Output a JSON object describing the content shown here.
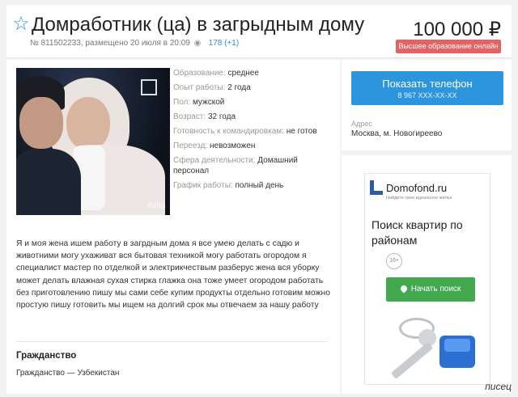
{
  "listing": {
    "title": "Домработник (ца) в загрыдным дому",
    "price": "100 000 ₽",
    "meta": "№ 811502233, размещено 20 июля в 20:09",
    "views": "178 (+1)",
    "badge": "Высшее образование онлайн"
  },
  "photo": {
    "watermark": "Avito"
  },
  "specs": [
    {
      "key": "Образование:",
      "value": "среднее"
    },
    {
      "key": "Опыт работы:",
      "value": "2 года"
    },
    {
      "key": "Пол:",
      "value": "мужской"
    },
    {
      "key": "Возраст:",
      "value": "32 года"
    },
    {
      "key": "Готовность к командировкам:",
      "value": "не готов"
    },
    {
      "key": "Переезд:",
      "value": "невозможен"
    },
    {
      "key": "Сфера деятельности:",
      "value": "Домашний персонал"
    },
    {
      "key": "График работы:",
      "value": "полный день"
    }
  ],
  "description": "Я и моя жена ишем работу в загрдным дома я все умею делать с садю и животними могу ухаживат вся бытовая техникой могу работать огородом я специалист мастер по отделкой и электрикчествым разберус жена вся уборку может делать влажная сухая стирка глажка она тоже умеет огородом работать без приготовлению пишу мы сами себе купим продукты отдельно готовим можно простую пишу готовить мы ищем на долгий срок мы отвечаем за нашу работу",
  "citizenship": {
    "heading": "Гражданство",
    "value": "Гражданство — Узбекистан"
  },
  "contact": {
    "button_label": "Показать телефон",
    "phone_masked": "8 967 XXX-XX-XX",
    "address_label": "Адрес",
    "address_value": "Москва, м. Новогиреево"
  },
  "ad": {
    "brand": "Domofond.ru",
    "tagline": "Найдите свое идеальное жилье",
    "headline": "Поиск квартир по районам",
    "age": "16+",
    "button": "Начать поиск"
  },
  "corner_watermark": "писец",
  "colors": {
    "accent": "#2c95de",
    "badge": "#e36264",
    "ad_button": "#43a94e"
  }
}
